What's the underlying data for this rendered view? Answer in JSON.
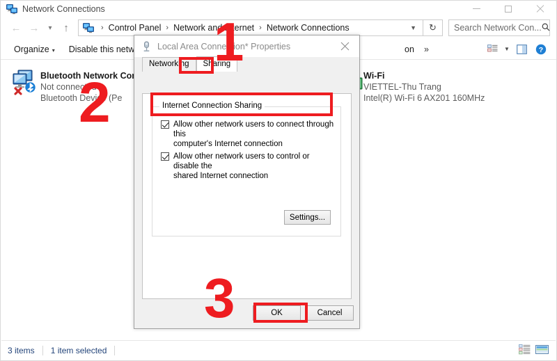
{
  "window": {
    "title": "Network Connections",
    "app_icon": "network-connections-icon",
    "buttons": {
      "minimize": "minimize-icon",
      "maximize": "maximize-icon",
      "close": "close-icon"
    }
  },
  "address_bar": {
    "back": "back-arrow-icon",
    "forward": "forward-arrow-icon",
    "recent": "chevron-down-icon",
    "up": "up-arrow-icon",
    "crumb_icon": "network-connections-icon",
    "breadcrumbs": [
      "Control Panel",
      "Network and Internet",
      "Network Connections"
    ],
    "separator": "›",
    "dropdown": "chevron-down-icon",
    "refresh": "refresh-icon",
    "search": {
      "placeholder": "Search Network Con...",
      "icon": "search-icon"
    }
  },
  "command_bar": {
    "organize": "Organize",
    "organize_caret": "▾",
    "disable": "Disable this network d",
    "truncated_item": "on",
    "overflow": "»",
    "right_icons": [
      "change-view-icon",
      "view-caret-icon",
      "preview-pane-icon",
      "help-icon"
    ]
  },
  "connections": [
    {
      "name": "Bluetooth Network Conn",
      "status": "Not connected",
      "device": "Bluetooth Device (Pe",
      "icon": "bluetooth-network-adapter-icon"
    },
    {
      "name": "Wi-Fi",
      "status": "VIETTEL-Thu Trang",
      "device": "Intel(R) Wi-Fi 6 AX201 160MHz",
      "icon": "wifi-adapter-icon"
    }
  ],
  "status_bar": {
    "item_count": "3 items",
    "selection": "1 item selected",
    "view_details_icon": "details-view-icon",
    "view_large_icon": "large-icons-view-icon"
  },
  "dialog": {
    "icon": "network-adapter-icon",
    "title": "Local Area Connection*  Properties",
    "close": "close-icon",
    "tabs": [
      {
        "label": "Networking",
        "active": false
      },
      {
        "label": "Sharing",
        "active": true
      }
    ],
    "group_label": "Internet Connection Sharing",
    "checkboxes": [
      {
        "checked": true,
        "line1": "Allow other network users to connect through this",
        "line2": "computer's Internet connection"
      },
      {
        "checked": true,
        "line1": "Allow other network users to control or disable the",
        "line2": "shared Internet connection"
      }
    ],
    "settings_button": "Settings...",
    "ok_button": "OK",
    "cancel_button": "Cancel"
  },
  "annotations": {
    "step1": "1",
    "step2": "2",
    "step3": "3",
    "color": "#ee1c20"
  }
}
